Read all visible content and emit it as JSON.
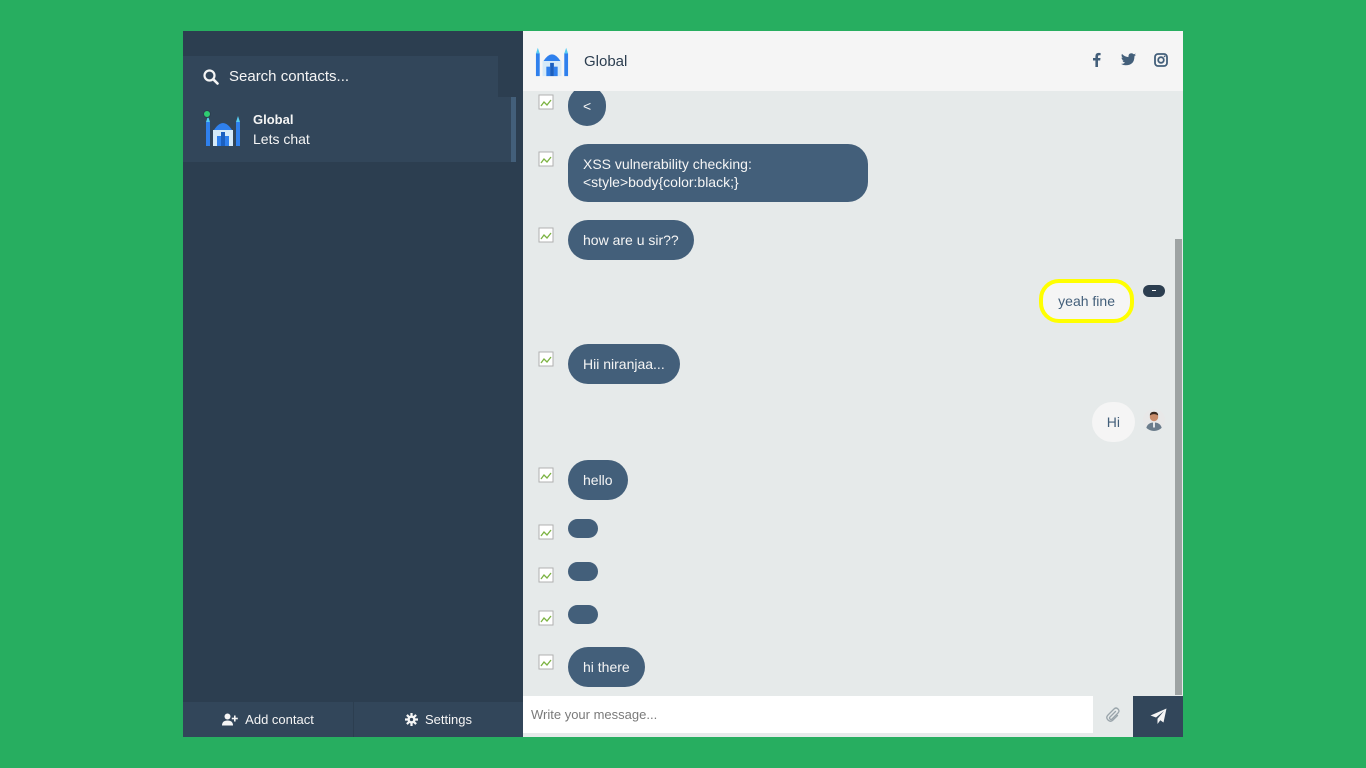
{
  "sidebar": {
    "search_placeholder": "Search contacts...",
    "contacts": [
      {
        "name": "Global",
        "preview": "Lets chat",
        "status": "online"
      }
    ],
    "add_contact_label": "Add contact",
    "settings_label": "Settings"
  },
  "chat": {
    "title": "Global",
    "social_icons": [
      "facebook-icon",
      "twitter-icon",
      "instagram-icon"
    ],
    "messages": [
      {
        "side": "sent",
        "text": "<"
      },
      {
        "side": "sent",
        "text": "XSS vulnerability checking:",
        "text2": "<style>body{color:black;}"
      },
      {
        "side": "sent",
        "text": "how are u sir??"
      },
      {
        "side": "reply",
        "text": "yeah fine"
      },
      {
        "side": "sent",
        "text": "Hii niranjaa..."
      },
      {
        "side": "reply",
        "text": "Hi"
      },
      {
        "side": "sent",
        "text": "hello"
      },
      {
        "side": "sent",
        "text": ""
      },
      {
        "side": "sent",
        "text": ""
      },
      {
        "side": "sent",
        "text": ""
      },
      {
        "side": "sent",
        "text": "hi there"
      }
    ],
    "input_placeholder": "Write your message..."
  },
  "colors": {
    "page_background": "#27ae60",
    "sidebar": "#2c3e50",
    "sidebar_active": "#32465a",
    "bubble_sent": "#435f7a",
    "bubble_reply": "#f5f5f5",
    "highlight_outline": "#ffff00",
    "online_status": "#2ecc71"
  }
}
